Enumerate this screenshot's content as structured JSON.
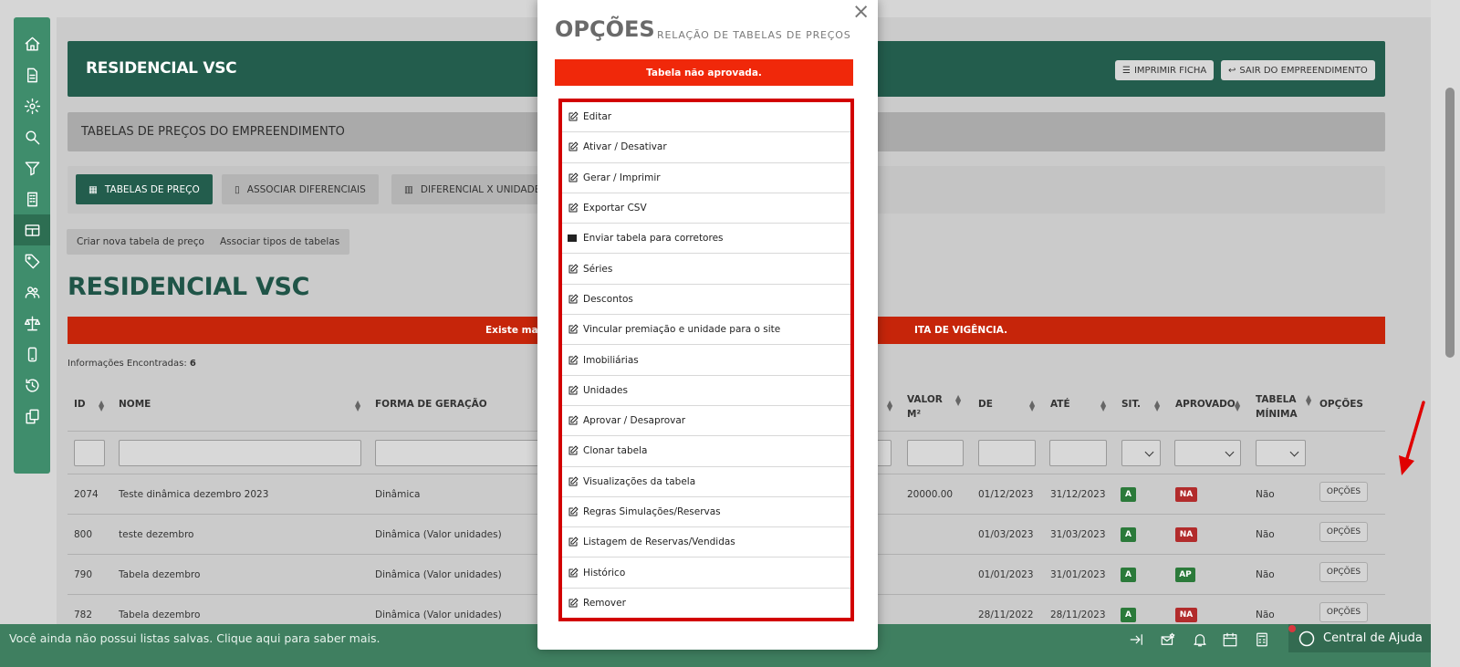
{
  "header": {
    "title": "RESIDENCIAL VSC",
    "print_label": "IMPRIMIR FICHA",
    "exit_label": "SAIR DO EMPREENDIMENTO"
  },
  "subheader": {
    "title": "TABELAS DE PREÇOS DO EMPREENDIMENTO"
  },
  "tabs": [
    {
      "label": "TABELAS DE PREÇO"
    },
    {
      "label": "ASSOCIAR DIFERENCIAIS"
    },
    {
      "label": "DIFERENCIAL X UNIDADE"
    }
  ],
  "actions": {
    "create_label": "Criar nova tabela de preço",
    "associate_label": "Associar tipos de tabelas"
  },
  "page_title": "RESIDENCIAL VSC",
  "alert": {
    "left": "Existe mai",
    "right": "ITA DE VIGÊNCIA."
  },
  "found": {
    "label": "Informações Encontradas:",
    "count": "6"
  },
  "columns": {
    "id": "ID",
    "nome": "NOME",
    "forma": "FORMA DE GERAÇÃO",
    "valor_m2_1": "VALOR",
    "valor_m2_2": "M²",
    "de": "DE",
    "ate": "ATÉ",
    "sit": "SIT.",
    "aprovado": "APROVADO",
    "tabela_min_1": "TABELA",
    "tabela_min_2": "MÍNIMA",
    "opcoes": "OPÇÕES"
  },
  "rows": [
    {
      "id": "2074",
      "nome": "Teste dinâmica dezembro 2023",
      "forma": "Dinâmica",
      "valor": "20000.00",
      "de": "01/12/2023",
      "ate": "31/12/2023",
      "sit": "A",
      "aprovado": "NA",
      "minima": "Não",
      "btn": "OPÇÕES"
    },
    {
      "id": "800",
      "nome": "teste dezembro",
      "forma": "Dinâmica (Valor unidades)",
      "valor": "",
      "de": "01/03/2023",
      "ate": "31/03/2023",
      "sit": "A",
      "aprovado": "NA",
      "minima": "Não",
      "btn": "OPÇÕES"
    },
    {
      "id": "790",
      "nome": "Tabela dezembro",
      "forma": "Dinâmica (Valor unidades)",
      "valor": "",
      "de": "01/01/2023",
      "ate": "31/01/2023",
      "sit": "A",
      "aprovado": "AP",
      "minima": "Não",
      "btn": "OPÇÕES"
    },
    {
      "id": "782",
      "nome": "Tabela dezembro",
      "forma": "Dinâmica (Valor unidades)",
      "valor": "",
      "de": "28/11/2022",
      "ate": "28/11/2023",
      "sit": "A",
      "aprovado": "NA",
      "minima": "Não",
      "btn": "OPÇÕES"
    }
  ],
  "modal": {
    "title": "OPÇÕES",
    "subtitle": "RELAÇÃO DE TABELAS DE PREÇOS",
    "alert": "Tabela não aprovada.",
    "close": "×",
    "items": [
      {
        "label": "Editar",
        "icon": "edit-icon"
      },
      {
        "label": "Ativar / Desativar",
        "icon": "edit-icon"
      },
      {
        "label": "Gerar / Imprimir",
        "icon": "edit-icon"
      },
      {
        "label": "Exportar CSV",
        "icon": "edit-icon"
      },
      {
        "label": "Enviar tabela para corretores",
        "icon": "envelope-icon"
      },
      {
        "label": "Séries",
        "icon": "edit-icon"
      },
      {
        "label": "Descontos",
        "icon": "edit-icon"
      },
      {
        "label": "Vincular premiação e unidade para o site",
        "icon": "edit-icon"
      },
      {
        "label": "Imobiliárias",
        "icon": "edit-icon"
      },
      {
        "label": "Unidades",
        "icon": "edit-icon"
      },
      {
        "label": "Aprovar / Desaprovar",
        "icon": "edit-icon"
      },
      {
        "label": "Clonar tabela",
        "icon": "edit-icon"
      },
      {
        "label": "Visualizações da tabela",
        "icon": "edit-icon"
      },
      {
        "label": "Regras Simulações/Reservas",
        "icon": "edit-icon"
      },
      {
        "label": "Listagem de Reservas/Vendidas",
        "icon": "edit-icon"
      },
      {
        "label": "Histórico",
        "icon": "edit-icon"
      },
      {
        "label": "Remover",
        "icon": "edit-icon"
      }
    ]
  },
  "bottom": {
    "message": "Você ainda não possui listas salvas. Clique aqui para saber mais.",
    "help_label": "Central de Ajuda"
  },
  "colors": {
    "brand_dark": "#235d4d",
    "brand": "#3f8d6c",
    "alert": "#f0280a",
    "highlight": "#d20000"
  }
}
